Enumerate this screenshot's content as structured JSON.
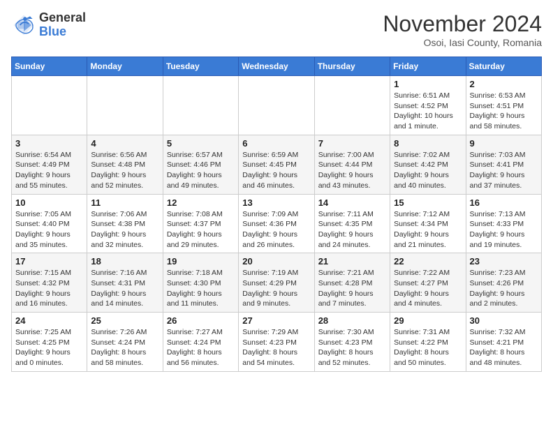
{
  "logo": {
    "general": "General",
    "blue": "Blue"
  },
  "title": "November 2024",
  "subtitle": "Osoi, Iasi County, Romania",
  "weekdays": [
    "Sunday",
    "Monday",
    "Tuesday",
    "Wednesday",
    "Thursday",
    "Friday",
    "Saturday"
  ],
  "weeks": [
    [
      {
        "day": "",
        "info": ""
      },
      {
        "day": "",
        "info": ""
      },
      {
        "day": "",
        "info": ""
      },
      {
        "day": "",
        "info": ""
      },
      {
        "day": "",
        "info": ""
      },
      {
        "day": "1",
        "info": "Sunrise: 6:51 AM\nSunset: 4:52 PM\nDaylight: 10 hours and 1 minute."
      },
      {
        "day": "2",
        "info": "Sunrise: 6:53 AM\nSunset: 4:51 PM\nDaylight: 9 hours and 58 minutes."
      }
    ],
    [
      {
        "day": "3",
        "info": "Sunrise: 6:54 AM\nSunset: 4:49 PM\nDaylight: 9 hours and 55 minutes."
      },
      {
        "day": "4",
        "info": "Sunrise: 6:56 AM\nSunset: 4:48 PM\nDaylight: 9 hours and 52 minutes."
      },
      {
        "day": "5",
        "info": "Sunrise: 6:57 AM\nSunset: 4:46 PM\nDaylight: 9 hours and 49 minutes."
      },
      {
        "day": "6",
        "info": "Sunrise: 6:59 AM\nSunset: 4:45 PM\nDaylight: 9 hours and 46 minutes."
      },
      {
        "day": "7",
        "info": "Sunrise: 7:00 AM\nSunset: 4:44 PM\nDaylight: 9 hours and 43 minutes."
      },
      {
        "day": "8",
        "info": "Sunrise: 7:02 AM\nSunset: 4:42 PM\nDaylight: 9 hours and 40 minutes."
      },
      {
        "day": "9",
        "info": "Sunrise: 7:03 AM\nSunset: 4:41 PM\nDaylight: 9 hours and 37 minutes."
      }
    ],
    [
      {
        "day": "10",
        "info": "Sunrise: 7:05 AM\nSunset: 4:40 PM\nDaylight: 9 hours and 35 minutes."
      },
      {
        "day": "11",
        "info": "Sunrise: 7:06 AM\nSunset: 4:38 PM\nDaylight: 9 hours and 32 minutes."
      },
      {
        "day": "12",
        "info": "Sunrise: 7:08 AM\nSunset: 4:37 PM\nDaylight: 9 hours and 29 minutes."
      },
      {
        "day": "13",
        "info": "Sunrise: 7:09 AM\nSunset: 4:36 PM\nDaylight: 9 hours and 26 minutes."
      },
      {
        "day": "14",
        "info": "Sunrise: 7:11 AM\nSunset: 4:35 PM\nDaylight: 9 hours and 24 minutes."
      },
      {
        "day": "15",
        "info": "Sunrise: 7:12 AM\nSunset: 4:34 PM\nDaylight: 9 hours and 21 minutes."
      },
      {
        "day": "16",
        "info": "Sunrise: 7:13 AM\nSunset: 4:33 PM\nDaylight: 9 hours and 19 minutes."
      }
    ],
    [
      {
        "day": "17",
        "info": "Sunrise: 7:15 AM\nSunset: 4:32 PM\nDaylight: 9 hours and 16 minutes."
      },
      {
        "day": "18",
        "info": "Sunrise: 7:16 AM\nSunset: 4:31 PM\nDaylight: 9 hours and 14 minutes."
      },
      {
        "day": "19",
        "info": "Sunrise: 7:18 AM\nSunset: 4:30 PM\nDaylight: 9 hours and 11 minutes."
      },
      {
        "day": "20",
        "info": "Sunrise: 7:19 AM\nSunset: 4:29 PM\nDaylight: 9 hours and 9 minutes."
      },
      {
        "day": "21",
        "info": "Sunrise: 7:21 AM\nSunset: 4:28 PM\nDaylight: 9 hours and 7 minutes."
      },
      {
        "day": "22",
        "info": "Sunrise: 7:22 AM\nSunset: 4:27 PM\nDaylight: 9 hours and 4 minutes."
      },
      {
        "day": "23",
        "info": "Sunrise: 7:23 AM\nSunset: 4:26 PM\nDaylight: 9 hours and 2 minutes."
      }
    ],
    [
      {
        "day": "24",
        "info": "Sunrise: 7:25 AM\nSunset: 4:25 PM\nDaylight: 9 hours and 0 minutes."
      },
      {
        "day": "25",
        "info": "Sunrise: 7:26 AM\nSunset: 4:24 PM\nDaylight: 8 hours and 58 minutes."
      },
      {
        "day": "26",
        "info": "Sunrise: 7:27 AM\nSunset: 4:24 PM\nDaylight: 8 hours and 56 minutes."
      },
      {
        "day": "27",
        "info": "Sunrise: 7:29 AM\nSunset: 4:23 PM\nDaylight: 8 hours and 54 minutes."
      },
      {
        "day": "28",
        "info": "Sunrise: 7:30 AM\nSunset: 4:23 PM\nDaylight: 8 hours and 52 minutes."
      },
      {
        "day": "29",
        "info": "Sunrise: 7:31 AM\nSunset: 4:22 PM\nDaylight: 8 hours and 50 minutes."
      },
      {
        "day": "30",
        "info": "Sunrise: 7:32 AM\nSunset: 4:21 PM\nDaylight: 8 hours and 48 minutes."
      }
    ]
  ]
}
